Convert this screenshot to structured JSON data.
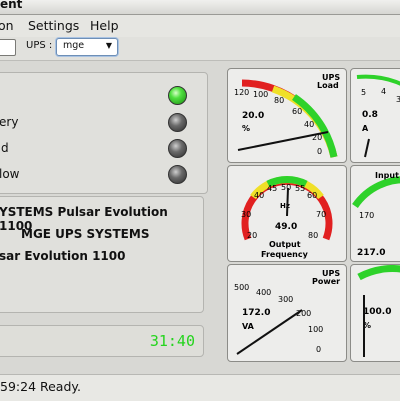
{
  "window": {
    "title": "ent"
  },
  "menu": [
    "on",
    "Settings",
    "Help"
  ],
  "toolbar": {
    "ups_label": "UPS :",
    "ups_value": "mge"
  },
  "leds": [
    {
      "label": "",
      "state": "on"
    },
    {
      "label": "ery",
      "state": "off"
    },
    {
      "label": "d",
      "state": "off"
    },
    {
      "label": "low",
      "state": "off"
    }
  ],
  "info": [
    "YSTEMS Pulsar Evolution 1100",
    "MGE UPS SYSTEMS",
    "sar Evolution 1100"
  ],
  "runtime": "31:40",
  "status": "59:24 Ready.",
  "gauges": {
    "load": {
      "title1": "UPS",
      "title2": "Load",
      "ticks": [
        "120",
        "100",
        "80",
        "60",
        "40",
        "20",
        "0"
      ],
      "value": "20.0",
      "unit": "%"
    },
    "battery": {
      "ticks": [
        "5",
        "4",
        "3"
      ],
      "value": "0.8",
      "unit": "A"
    },
    "freq": {
      "ticks": [
        "40",
        "45",
        "50",
        "55",
        "60",
        "70",
        "80",
        "20",
        "30"
      ],
      "center": "Hz",
      "value": "49.0",
      "label1": "Output",
      "label2": "Frequency"
    },
    "input": {
      "title": "Input",
      "ticks": [
        "170"
      ],
      "value": "217.0"
    },
    "power": {
      "title1": "UPS",
      "title2": "Power",
      "ticks": [
        "500",
        "400",
        "300",
        "200",
        "100",
        "0"
      ],
      "value": "172.0",
      "unit": "VA"
    },
    "extra": {
      "value": "100.0",
      "unit": "%"
    }
  },
  "colors": {
    "led_on": "#3ad42a",
    "lcd": "#25d41e",
    "gauge_red": "#e12020",
    "gauge_yellow": "#f0e028",
    "gauge_green": "#2ed22a"
  }
}
